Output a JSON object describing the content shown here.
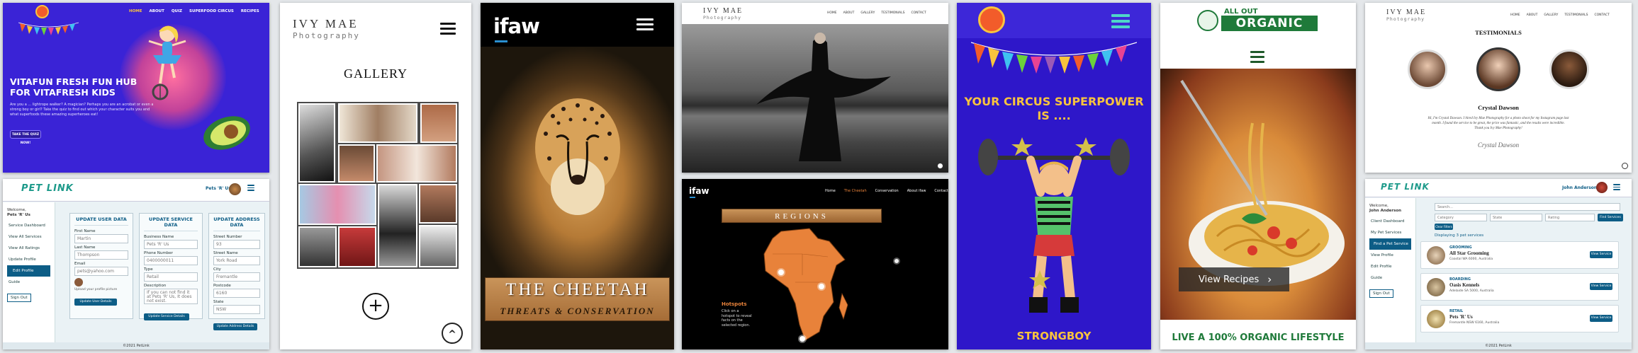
{
  "vitafun": {
    "nav": [
      "HOME",
      "ABOUT",
      "QUIZ",
      "SUPERFOOD CIRCUS",
      "RECIPES"
    ],
    "headline": "VITAFUN FRESH FUN HUB FOR VITAFRESH KIDS",
    "body": "Are you a ... lightrope walker? A magician? Perhaps you are an acrobat or even a strong boy or girl? Take the quiz to find out which your character suits you and what superfoods these amazing superheroes eat!",
    "cta": "TAKE THE QUIZ NOW!",
    "colors": {
      "bg": "#3a23d6",
      "accent": "#f5a623"
    }
  },
  "ivy_gallery": {
    "brand_top": "IVY MAE",
    "brand_bottom": "Photography",
    "heading": "GALLERY",
    "add_symbol": "+",
    "up_symbol": "^"
  },
  "ifaw": {
    "brand": "ifaw",
    "title": "The Cheetah",
    "subtitle": "Threats & Conservation"
  },
  "ivy_home": {
    "brand_top": "IVY MAE",
    "brand_bottom": "Photography",
    "nav": [
      "HOME",
      "ABOUT",
      "GALLERY",
      "TESTIMONIALS",
      "CONTACT"
    ]
  },
  "ifaw_map": {
    "brand": "ifaw",
    "nav": [
      "Home",
      "The Cheetah",
      "Conservation",
      "About ifaw",
      "Contact"
    ],
    "banner": "REGIONS",
    "hotspots_title": "Hotspots",
    "hotspots_text": "Click on a hotspot to reveal facts on the selected region."
  },
  "circus": {
    "headline": "YOUR CIRCUS SUPERPOWER IS ....",
    "result": "STRONGBOY"
  },
  "organic": {
    "logo_top": "ALL OUT",
    "logo_main": "ORGANIC",
    "cta": "View Recipes",
    "footer": "LIVE A 100% ORGANIC LIFESTYLE"
  },
  "ivy_testimonials": {
    "brand_top": "IVY MAE",
    "brand_bottom": "Photography",
    "nav": [
      "HOME",
      "ABOUT",
      "GALLERY",
      "TESTIMONIALS",
      "CONTACT"
    ],
    "heading": "TESTIMONIALS",
    "name": "Crystal Dawson",
    "quote": "Hi, I'm Crystal Dawson. I hired Ivy Mae Photography for a photo shoot for my Instagram page last month. I found the service to be great, the price was fantastic, and the results were incredible. Thank you Ivy Mae Photography!",
    "signature": "Crystal Dawson"
  },
  "petlink_edit": {
    "logo": "PET LINK",
    "user": "Pets 'R' Us",
    "welcome": "Welcome,",
    "welcome_name": "Pets 'R' Us",
    "sidebar": [
      "Service Dashboard",
      "View All Services",
      "View All Ratings",
      "Update Profile",
      "Edit Profile",
      "Guide",
      "Sign Out"
    ],
    "card1": {
      "title": "UPDATE USER DATA",
      "labels": [
        "First Name",
        "Last Name",
        "Email"
      ],
      "values": [
        "Martin",
        "Thompson",
        "pets@yahoo.com"
      ],
      "caption": "Upload your profile picture",
      "button": "Update User Details"
    },
    "card2": {
      "title": "UPDATE SERVICE DATA",
      "labels": [
        "Business Name",
        "Phone Number",
        "Type",
        "Description"
      ],
      "values": [
        "Pets 'R' Us",
        "0400000011",
        "Retail",
        "If you can not find it at Pets 'R' Us, It does not exist."
      ],
      "button": "Update Service Details"
    },
    "card3": {
      "title": "UPDATE ADDRESS DATA",
      "labels": [
        "Street Number",
        "Street Name",
        "City",
        "Postcode",
        "State"
      ],
      "values": [
        "93",
        "York Road",
        "Fremantle",
        "6160",
        "NSW"
      ],
      "button": "Update Address Details"
    },
    "footer": "©2021 PetLink"
  },
  "petlink_search": {
    "logo": "PET LINK",
    "user": "John Anderson",
    "welcome": "Welcome,",
    "welcome_name": "John Anderson",
    "sidebar": [
      "Client Dashboard",
      "My Pet Services",
      "Find a Pet Service",
      "View Profile",
      "Edit Profile",
      "Guide",
      "Sign Out"
    ],
    "search_placeholder": "Search...",
    "filters": [
      "Category",
      "State",
      "Rating"
    ],
    "find_button": "Find Services",
    "clear_button": "Clear Filters",
    "results_label": "Displaying 3 pet services",
    "results": [
      {
        "category": "GROOMING",
        "name": "All Star Grooming",
        "address": "Coastal WA 6000, Australia",
        "button": "View Service"
      },
      {
        "category": "BOARDING",
        "name": "Oasis Kennels",
        "address": "Adelaide SA 5000, Australia",
        "button": "View Service"
      },
      {
        "category": "RETAIL",
        "name": "Pets 'R' Us",
        "address": "Fremantle NSW 6160, Australia",
        "button": "View Service"
      }
    ],
    "footer": "©2021 PetLink"
  }
}
